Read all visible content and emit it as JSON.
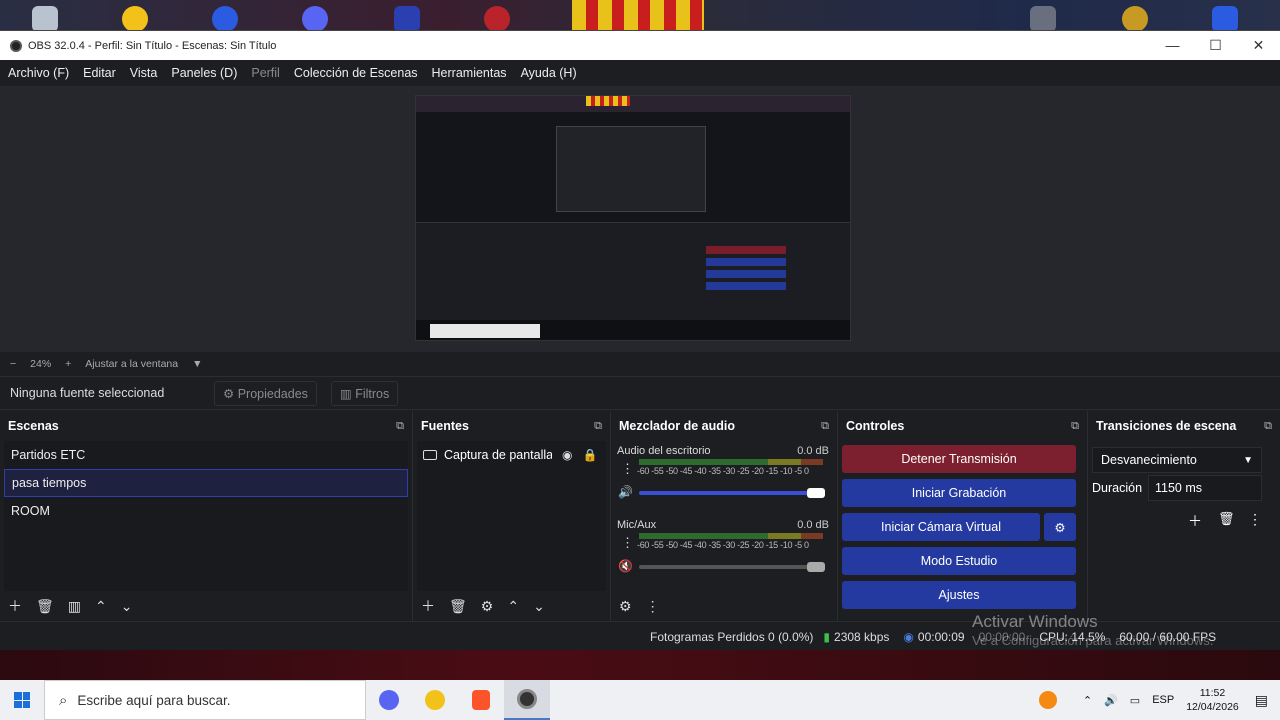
{
  "window": {
    "title": "OBS 32.0.4 - Perfil: Sin Título - Escenas: Sin Título"
  },
  "menu": [
    "Archivo (F)",
    "Editar",
    "Vista",
    "Paneles (D)",
    "Perfil",
    "Colección de Escenas",
    "Herramientas",
    "Ayuda (H)"
  ],
  "zoom": {
    "minus": "−",
    "value": "24%",
    "plus": "+",
    "fit": "Ajustar a la ventana"
  },
  "propbar": {
    "no_selection": "Ninguna fuente seleccionad",
    "properties": "Propiedades",
    "filters": "Filtros"
  },
  "scenes": {
    "title": "Escenas",
    "items": [
      "Partidos ETC",
      "pasa tiempos",
      "ROOM"
    ],
    "selected": "pasa tiempos"
  },
  "sources": {
    "title": "Fuentes",
    "items": [
      "Captura de pantalla"
    ]
  },
  "mixer": {
    "title": "Mezclador de audio",
    "scale": "-60 -55 -50 -45 -40 -35 -30 -25 -20 -15 -10 -5 0",
    "channels": [
      {
        "name": "Audio del escritorio",
        "db": "0.0 dB",
        "volume": 1.0,
        "muted": false
      },
      {
        "name": "Mic/Aux",
        "db": "0.0 dB",
        "volume": 1.0,
        "muted": true
      }
    ]
  },
  "controls": {
    "title": "Controles",
    "stop_stream": "Detener Transmisión",
    "start_recording": "Iniciar Grabación",
    "start_virtual_cam": "Iniciar Cámara Virtual",
    "studio_mode": "Modo Estudio",
    "settings": "Ajustes"
  },
  "transitions": {
    "title": "Transiciones de escena",
    "selected": "Desvanecimiento",
    "duration_label": "Duración",
    "duration_value": "1150 ms"
  },
  "status": {
    "dropped_frames": "Fotogramas Perdidos 0 (0.0%)",
    "bitrate": "2308 kbps",
    "stream_time": "00:00:09",
    "record_time": "00:00:00",
    "cpu": "CPU: 14.5%",
    "fps": "60.00 / 60.00 FPS"
  },
  "watermark": {
    "line1": "Activar Windows",
    "line2": "Ve a Configuración para activar Windows."
  },
  "taskbar": {
    "search_placeholder": "Escribe aquí para buscar.",
    "lang": "ESP",
    "time": "11:52",
    "date": "12/04/2026"
  },
  "colors": {
    "accent_blue": "#243aa0",
    "stop_red": "#7c1f2e",
    "panel_bg": "#1d1e22"
  }
}
